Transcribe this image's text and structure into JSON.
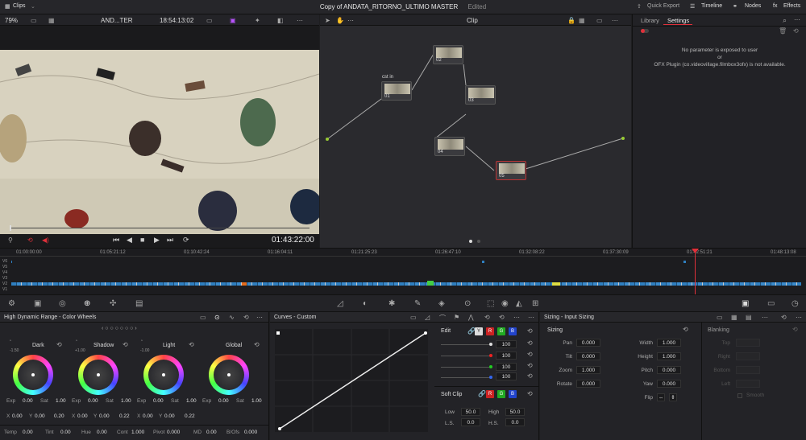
{
  "topbar": {
    "clips": "Clips",
    "project_title": "Copy of ANDATA_RITORNO_ULTIMO MASTER",
    "edited": "Edited",
    "quick_export": "Quick Export",
    "timeline": "Timeline",
    "nodes": "Nodes",
    "effects": "Effects"
  },
  "viewerbar": {
    "zoom": "79%",
    "clip_name": "AND...TER",
    "timecode": "18:54:13:02"
  },
  "nodebar": {
    "mode": "Clip"
  },
  "viewer": {
    "timecode": "01:43:22:00"
  },
  "nodes": {
    "cst_label": "cst in",
    "items": [
      {
        "id": "01"
      },
      {
        "id": "02"
      },
      {
        "id": "03"
      },
      {
        "id": "04"
      },
      {
        "id": "05"
      }
    ]
  },
  "sidebar": {
    "tab_library": "Library",
    "tab_settings": "Settings",
    "msg1": "No parameter is exposed to user",
    "msg2": "or",
    "msg3": "OFX Plugin (co.videovillage.filmbox3ofx) is not available."
  },
  "timeline": {
    "ruler": [
      "01:00:00:00",
      "01:05:21:12",
      "01:10:42:24",
      "01:16:04:11",
      "01:21:25:23",
      "01:26:47:10",
      "01:32:08:22",
      "01:37:30:09",
      "01:42:51:21",
      "01:48:13:08"
    ],
    "tracks": [
      "V6",
      "V5",
      "V4",
      "V3",
      "V2",
      "V1"
    ]
  },
  "wheels": {
    "title": "High Dynamic Range - Color Wheels",
    "items": [
      {
        "name": "Dark",
        "knob": "-1.50",
        "exp": "0.00",
        "sat": "1.00",
        "x": "0.00",
        "y": "0.00"
      },
      {
        "name": "Shadow",
        "knob": "+1.00",
        "exp": "0.00",
        "sat": "1.00",
        "x": "0.00",
        "y": "0.00"
      },
      {
        "name": "Light",
        "knob": "-1.00",
        "exp": "0.00",
        "sat": "1.00",
        "x": "0.00",
        "y": "0.00"
      },
      {
        "name": "Global",
        "knob": "",
        "exp": "0.00",
        "sat": "1.00",
        "x": "",
        "y": ""
      }
    ],
    "labels": {
      "exp": "Exp",
      "sat": "Sat",
      "x": "X",
      "y": "Y"
    },
    "ls1": "0.20",
    "ls2": "0.22",
    "ls3": "0.22",
    "bottom": [
      {
        "label": "Temp",
        "value": "0.00"
      },
      {
        "label": "Tint",
        "value": "0.00"
      },
      {
        "label": "Hue",
        "value": "0.00"
      },
      {
        "label": "Cont",
        "value": "1.000"
      },
      {
        "label": "Pivot",
        "value": "0.000"
      },
      {
        "label": "MD",
        "value": "0.00"
      },
      {
        "label": "B/Ofs",
        "value": "0.000"
      }
    ]
  },
  "curves": {
    "title": "Curves - Custom",
    "edit": "Edit",
    "channels": [
      "100",
      "100",
      "100",
      "100"
    ],
    "soft_clip": "Soft Clip",
    "low_label": "Low",
    "low": "50.0",
    "high_label": "High",
    "high": "50.0",
    "ls_label": "L.S.",
    "ls": "0.0",
    "hs_label": "H.S.",
    "hs": "0.0",
    "y": "Y",
    "r": "R",
    "g": "G",
    "b": "B"
  },
  "sizing": {
    "title": "Sizing - Input Sizing",
    "section": "Sizing",
    "pan_label": "Pan",
    "pan": "0.000",
    "tilt_label": "Tilt",
    "tilt": "0.000",
    "zoom_label": "Zoom",
    "zoom": "1.000",
    "rotate_label": "Rotate",
    "rotate": "0.000",
    "width_label": "Width",
    "width": "1.000",
    "height_label": "Height",
    "height": "1.000",
    "pitch_label": "Pitch",
    "pitch": "0.000",
    "yaw_label": "Yaw",
    "yaw": "0.000",
    "flip_label": "Flip",
    "blanking": "Blanking",
    "top": "Top",
    "right": "Right",
    "bottom": "Bottom",
    "left": "Left",
    "smooth": "Smooth"
  },
  "colors": {
    "accent": "#e0303a",
    "panel": "#232327"
  }
}
